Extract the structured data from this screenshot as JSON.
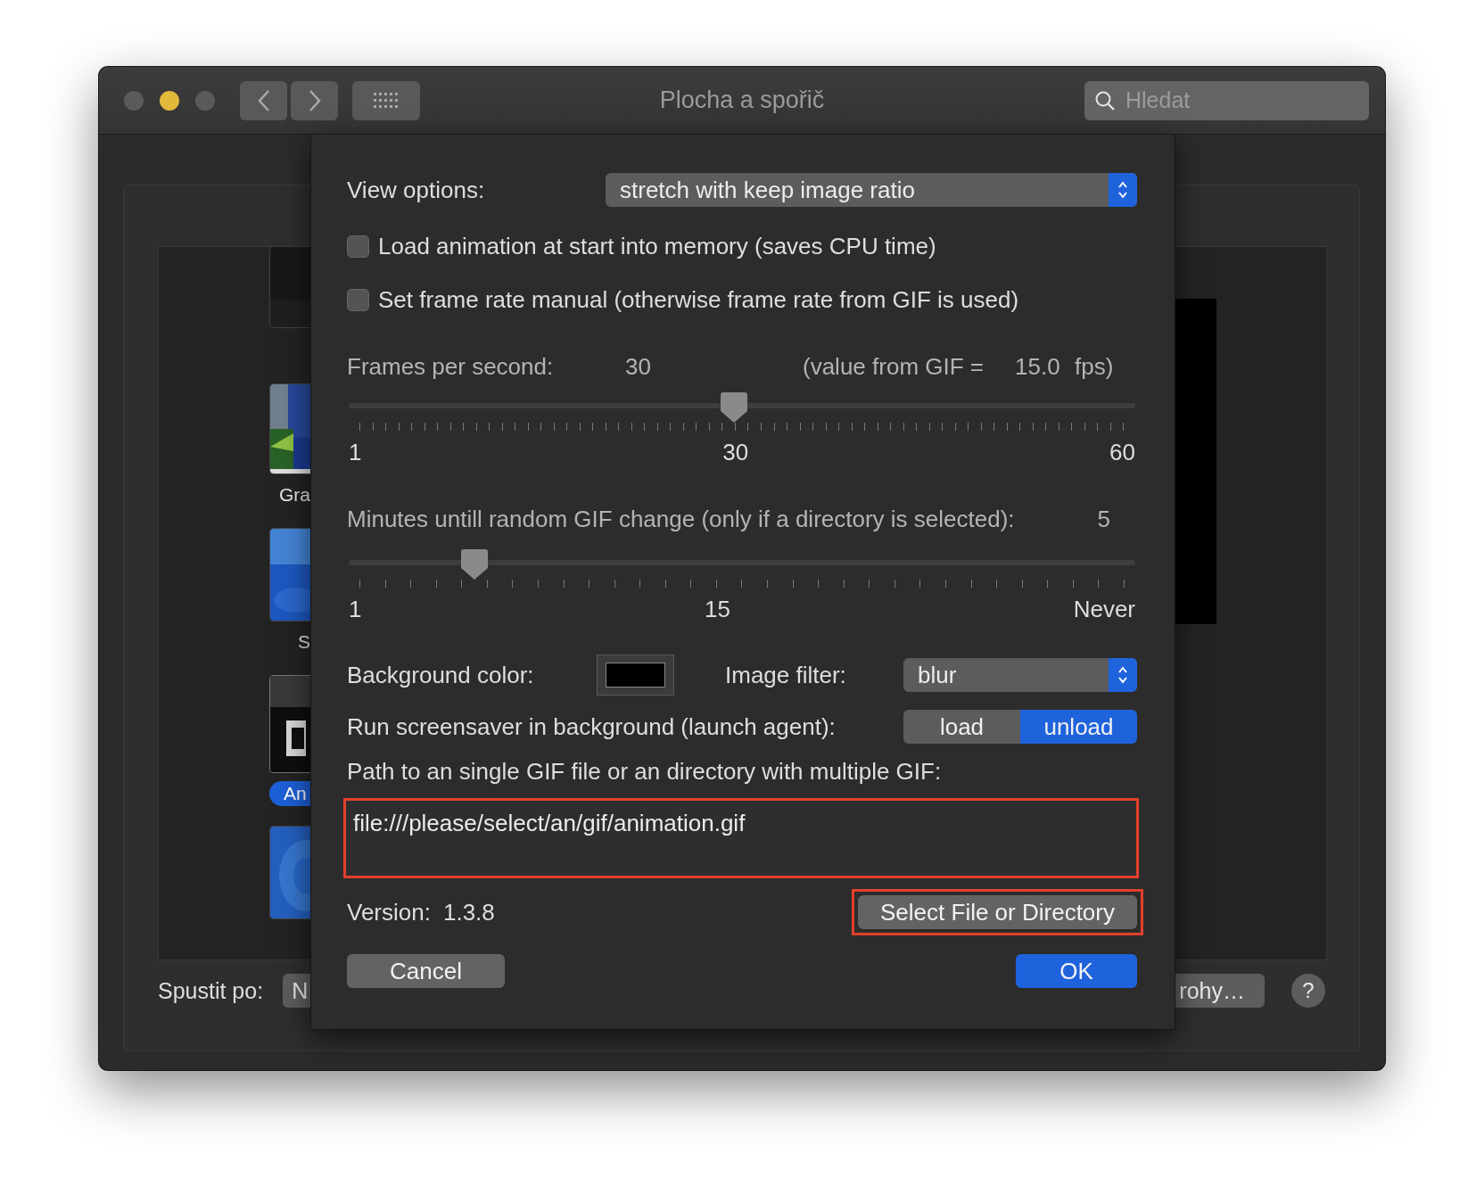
{
  "window": {
    "title": "Plocha a spořič"
  },
  "search": {
    "placeholder": "Hledat"
  },
  "thumbnails": [
    {
      "selected": false
    },
    {
      "label": "Gra",
      "selected": false
    },
    {
      "label": "S",
      "selected": false
    },
    {
      "label": "An",
      "selected": true
    },
    {
      "selected": false
    }
  ],
  "start_after": {
    "label": "Spustit po:",
    "value": "N"
  },
  "hot_corners_button": "rohy…",
  "help_button": "?",
  "sheet": {
    "view_options": {
      "label": "View options:",
      "value": "stretch with keep image ratio"
    },
    "checkboxes": [
      {
        "label": "Load animation at start into memory (saves CPU time)",
        "checked": false
      },
      {
        "label": "Set frame rate manual (otherwise frame rate from GIF is used)",
        "checked": false
      }
    ],
    "fps": {
      "label": "Frames per second:",
      "value": "30",
      "gif_note": "(value from GIF =",
      "gif_value": "15.0",
      "unit": "fps)"
    },
    "fps_slider": {
      "level": 0.49,
      "labels": [
        "1",
        "30",
        "60"
      ]
    },
    "minutes": {
      "label": "Minutes untill random GIF change (only if a directory is selected):",
      "value": "5"
    },
    "minutes_slider": {
      "level": 0.15,
      "labels": [
        "1",
        "15",
        "Never"
      ]
    },
    "background_color": {
      "label": "Background color:",
      "color": "#000000"
    },
    "image_filter": {
      "label": "Image filter:",
      "value": "blur"
    },
    "launch_agent": {
      "label": "Run screensaver in background (launch agent):",
      "options": [
        {
          "label": "load",
          "selected": false
        },
        {
          "label": "unload",
          "selected": true
        }
      ]
    },
    "path": {
      "label": "Path to an single GIF file or an directory with multiple GIF:",
      "value": "file:///please/select/an/gif/animation.gif",
      "highlighted": true
    },
    "version": {
      "label": "Version:",
      "value": "1.3.8"
    },
    "select_button": {
      "label": "Select File or Directory",
      "highlighted": true
    },
    "buttons": [
      {
        "label": "Cancel",
        "kind": "secondary"
      },
      {
        "label": "OK",
        "kind": "primary"
      }
    ]
  }
}
